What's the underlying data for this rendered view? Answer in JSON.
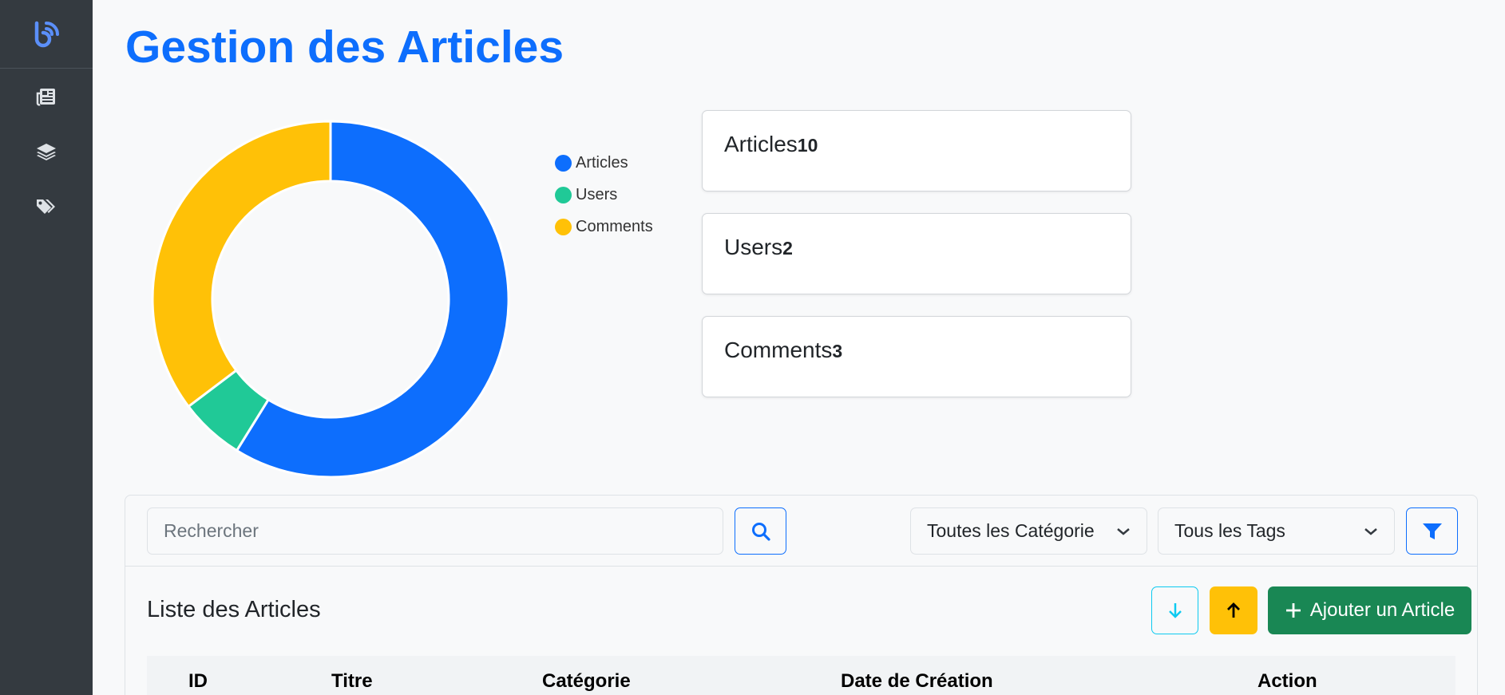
{
  "app": {
    "page_title": "Gestion des Articles"
  },
  "sidebar": {
    "logo_icon": "blog-logo-icon",
    "items": [
      {
        "icon": "newspaper-icon"
      },
      {
        "icon": "layers-icon"
      },
      {
        "icon": "tags-icon"
      }
    ]
  },
  "chart_data": {
    "type": "pie",
    "donut": true,
    "categories": [
      "Articles",
      "Users",
      "Comments"
    ],
    "values": [
      10,
      1,
      6
    ],
    "colors": [
      "#0d6efd",
      "#20c997",
      "#ffc107"
    ],
    "legend_position": "right"
  },
  "stats": [
    {
      "label": "Articles",
      "count": "10"
    },
    {
      "label": "Users",
      "count": "2"
    },
    {
      "label": "Comments",
      "count": "3"
    }
  ],
  "toolbar": {
    "search_placeholder": "Rechercher",
    "category_select": "Toutes les Catégorie",
    "tags_select": "Tous les Tags"
  },
  "list": {
    "title": "Liste des Articles",
    "add_label": "Ajouter un Article",
    "columns": [
      "ID",
      "Titre",
      "Catégorie",
      "Date de Création",
      "Action"
    ]
  },
  "colors": {
    "primary": "#0d6efd",
    "success": "#198754",
    "warning": "#ffc107",
    "info": "#0dcaf0",
    "sidebar": "#343a40"
  }
}
